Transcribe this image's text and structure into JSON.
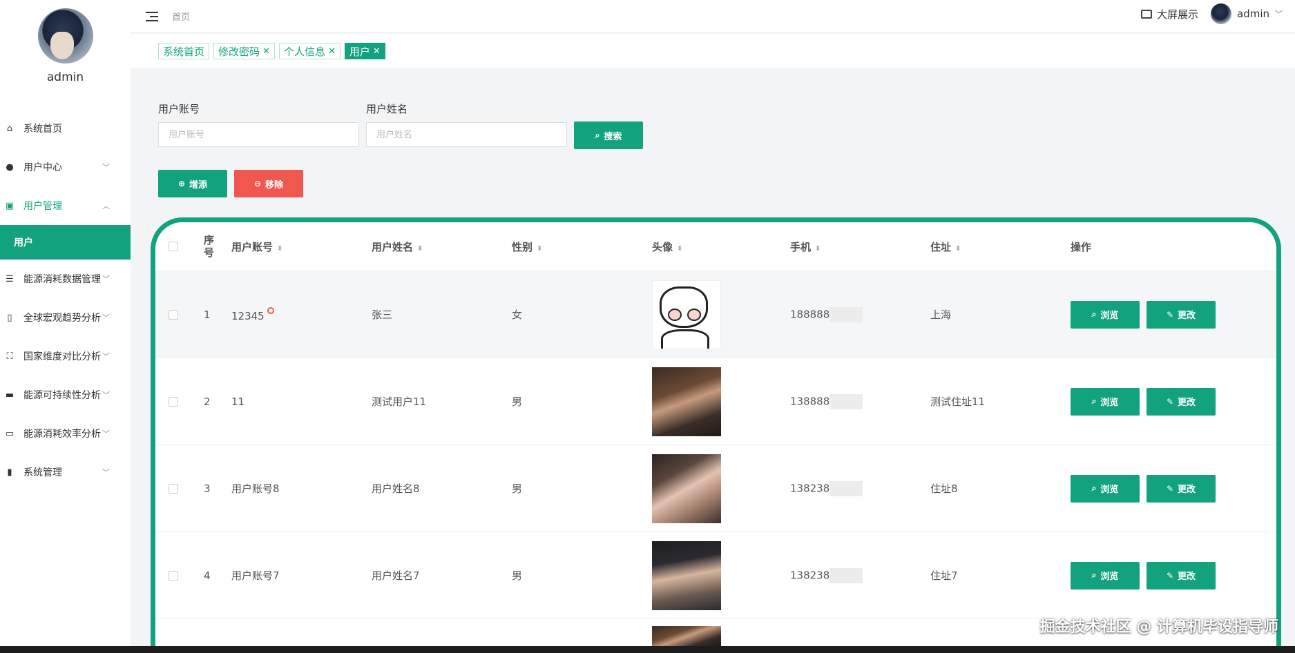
{
  "colors": {
    "accent": "#12a37e",
    "danger": "#f0574e"
  },
  "profile": {
    "name": "admin"
  },
  "sidebar": {
    "items": [
      {
        "label": "系统首页",
        "icon": "home-icon"
      },
      {
        "label": "用户中心",
        "icon": "user-icon"
      },
      {
        "label": "用户管理",
        "icon": "chart-icon"
      },
      {
        "label": "用户",
        "icon": ""
      },
      {
        "label": "能源消耗数据管理",
        "icon": "list-icon"
      },
      {
        "label": "全球宏观趋势分析",
        "icon": "phone-icon"
      },
      {
        "label": "国家维度对比分析",
        "icon": "fullscreen-icon"
      },
      {
        "label": "能源可持续性分析",
        "icon": "monitor-icon"
      },
      {
        "label": "能源消耗效率分析",
        "icon": "monitor-stand-icon"
      },
      {
        "label": "系统管理",
        "icon": "bar-chart-icon"
      }
    ]
  },
  "topbar": {
    "breadcrumb": "首页",
    "screen_label": "大屏展示",
    "user": "admin"
  },
  "tabs": [
    {
      "label": "系统首页",
      "closable": false
    },
    {
      "label": "修改密码",
      "closable": true
    },
    {
      "label": "个人信息",
      "closable": true
    },
    {
      "label": "用户",
      "closable": true,
      "active": true
    }
  ],
  "tab_close": "✕",
  "filters": {
    "account_label": "用户账号",
    "account_placeholder": "用户账号",
    "name_label": "用户姓名",
    "name_placeholder": "用户姓名",
    "search_label": "搜索"
  },
  "actions": {
    "add_label": "增添",
    "remove_label": "移除"
  },
  "table": {
    "headers": {
      "index": "序号",
      "account": "用户账号",
      "name": "用户姓名",
      "gender": "性别",
      "avatar": "头像",
      "phone": "手机",
      "address": "住址",
      "ops": "操作"
    },
    "sort_glyph": "⬍",
    "view_label": "浏览",
    "edit_label": "更改",
    "rows": [
      {
        "index": "1",
        "account": "12345",
        "name": "张三",
        "gender": "女",
        "phone": "188888",
        "address": "上海"
      },
      {
        "index": "2",
        "account": "11",
        "name": "测试用户11",
        "gender": "男",
        "phone": "138888",
        "address": "测试住址11"
      },
      {
        "index": "3",
        "account": "用户账号8",
        "name": "用户姓名8",
        "gender": "男",
        "phone": "138238",
        "address": "住址8"
      },
      {
        "index": "4",
        "account": "用户账号7",
        "name": "用户姓名7",
        "gender": "男",
        "phone": "138238",
        "address": "住址7"
      }
    ]
  },
  "watermark": "掘金技术社区 @ 计算机毕设指导师"
}
